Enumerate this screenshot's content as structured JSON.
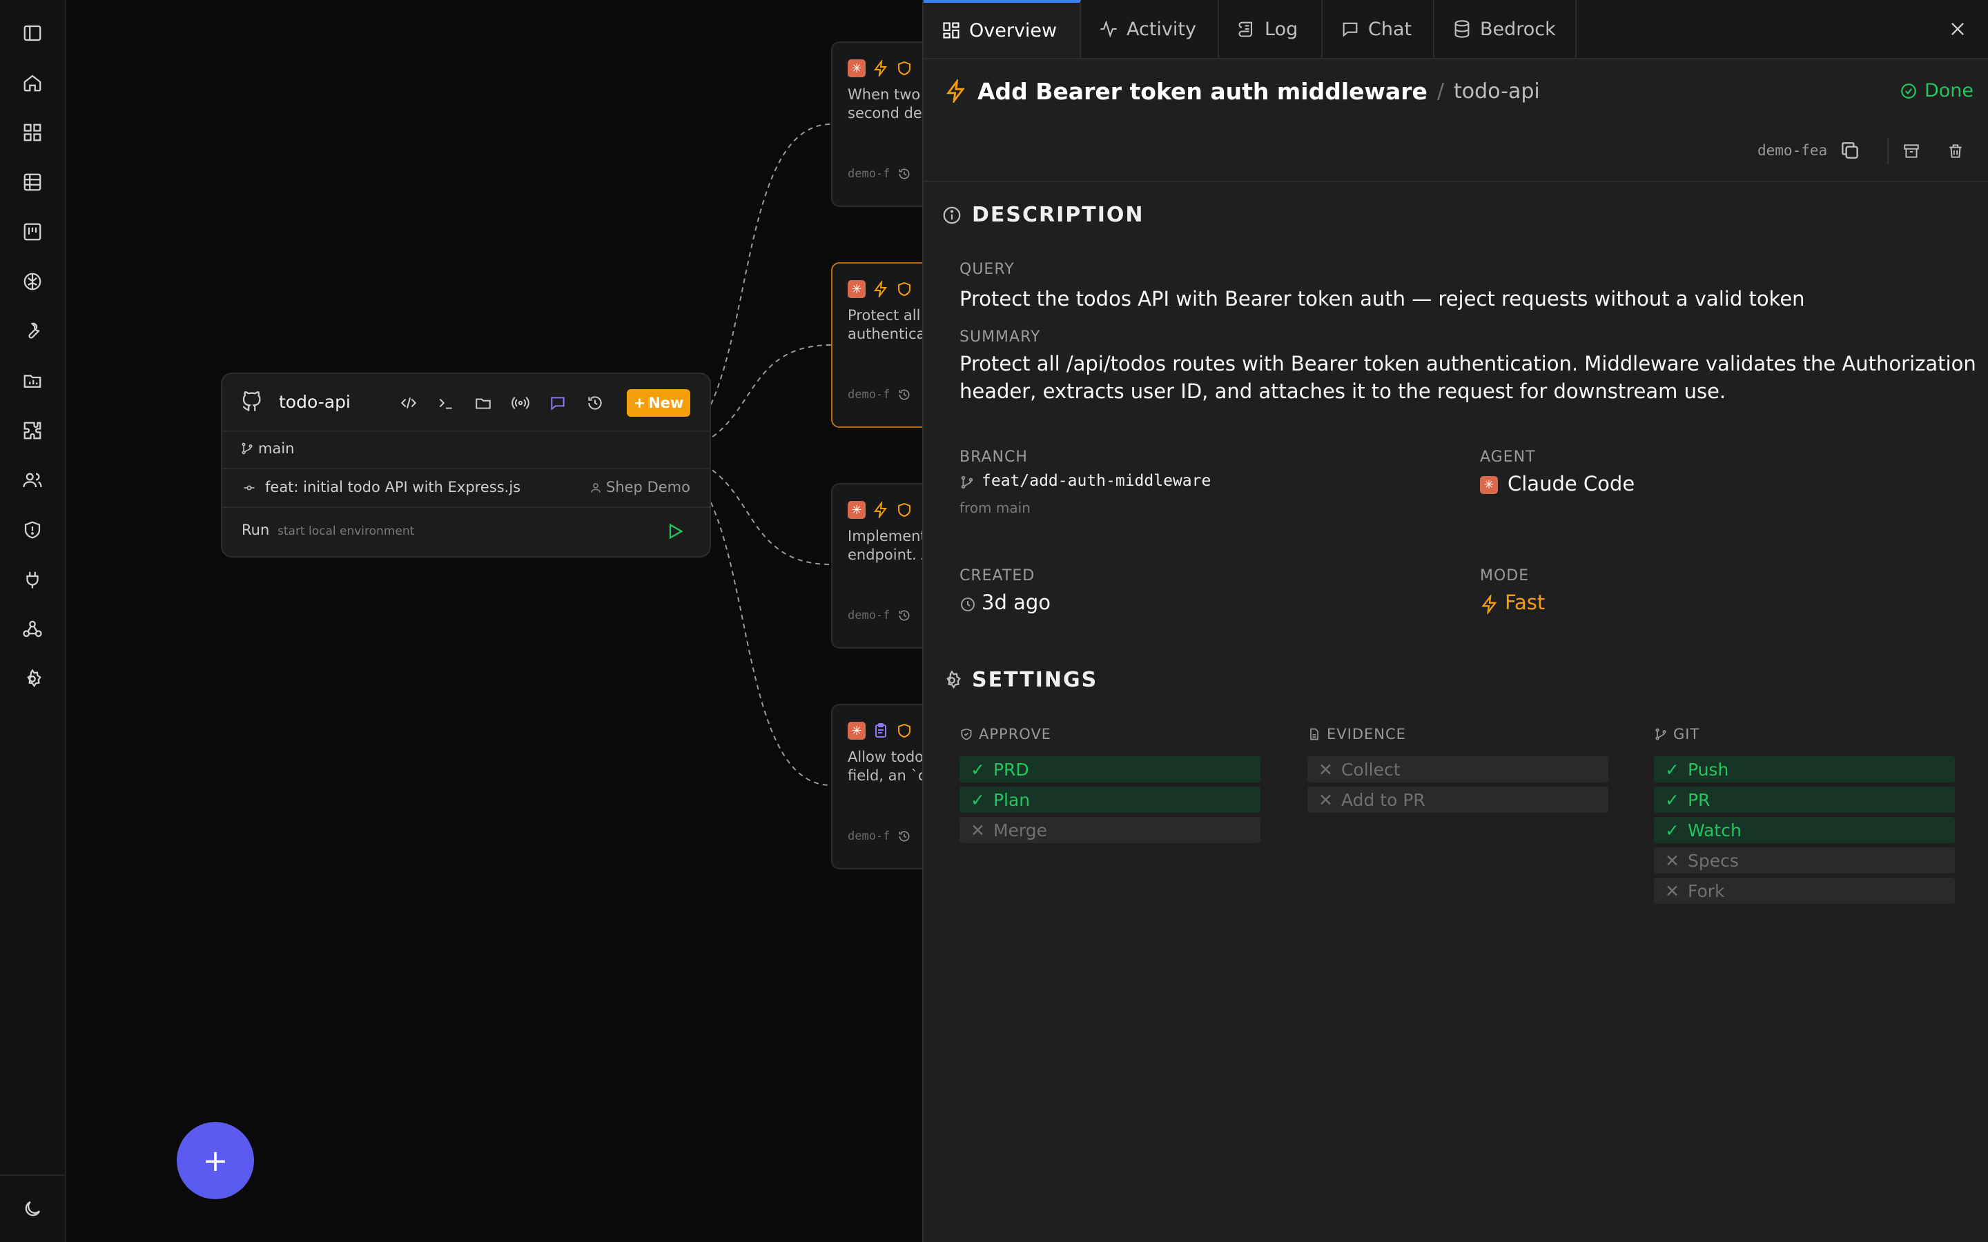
{
  "sidebar": {
    "items": [
      "sidebar-toggle",
      "home",
      "dashboard",
      "table",
      "board",
      "brain",
      "tools",
      "reports",
      "plugins",
      "team",
      "security",
      "integrations",
      "webhooks",
      "settings"
    ],
    "theme_icon": "moon-icon"
  },
  "repo_card": {
    "name": "todo-api",
    "new_label": "New",
    "branch": "main",
    "commit_message": "feat: initial todo API with Express.js",
    "commit_author": "Shep Demo",
    "run_label": "Run",
    "run_hint": "start local environment"
  },
  "feature_cards": [
    {
      "text": "When two\nsecond del",
      "branch": "demo-f",
      "active": false
    },
    {
      "text": "Protect all\nauthentica",
      "branch": "demo-f",
      "active": true
    },
    {
      "text": "Implement\nendpoint. A",
      "branch": "demo-f",
      "active": false
    },
    {
      "text": "Allow todos\nfield, an `o",
      "branch": "demo-f",
      "active": false
    }
  ],
  "fab": {
    "label": "+"
  },
  "panel": {
    "tabs": [
      {
        "label": "Overview",
        "icon": "grid-icon",
        "active": true
      },
      {
        "label": "Activity",
        "icon": "activity-icon",
        "active": false
      },
      {
        "label": "Log",
        "icon": "scroll-icon",
        "active": false
      },
      {
        "label": "Chat",
        "icon": "chat-icon",
        "active": false
      },
      {
        "label": "Bedrock",
        "icon": "database-icon",
        "active": false
      }
    ],
    "title": "Add Bearer token auth middleware",
    "crumb_sep": "/",
    "repo": "todo-api",
    "status": "Done",
    "branch_short": "demo-fea",
    "description": {
      "heading": "DESCRIPTION",
      "query_label": "QUERY",
      "query": "Protect the todos API with Bearer token auth — reject requests without a valid token",
      "summary_label": "SUMMARY",
      "summary_line1": "Protect all /api/todos routes with Bearer token authentication. Middleware validates the Authorization",
      "summary_line2": "header, extracts user ID, and attaches it to the request for downstream use.",
      "branch_label": "BRANCH",
      "branch": "feat/add-auth-middleware",
      "branch_from": "from main",
      "agent_label": "AGENT",
      "agent": "Claude Code",
      "created_label": "CREATED",
      "created": "3d ago",
      "mode_label": "MODE",
      "mode": "Fast"
    },
    "settings": {
      "heading": "SETTINGS",
      "approve": {
        "label": "APPROVE",
        "items": [
          {
            "label": "PRD",
            "on": true
          },
          {
            "label": "Plan",
            "on": true
          },
          {
            "label": "Merge",
            "on": false
          }
        ]
      },
      "evidence": {
        "label": "EVIDENCE",
        "items": [
          {
            "label": "Collect",
            "on": false
          },
          {
            "label": "Add to PR",
            "on": false
          }
        ]
      },
      "git": {
        "label": "GIT",
        "items": [
          {
            "label": "Push",
            "on": true
          },
          {
            "label": "PR",
            "on": true
          },
          {
            "label": "Watch",
            "on": true
          },
          {
            "label": "Specs",
            "on": false
          },
          {
            "label": "Fork",
            "on": false
          }
        ]
      }
    }
  },
  "colors": {
    "accent": "#3b82f6",
    "success": "#22c55e",
    "warning": "#f59e0b",
    "fab": "#5b5bf0",
    "claude": "#d9694a"
  }
}
